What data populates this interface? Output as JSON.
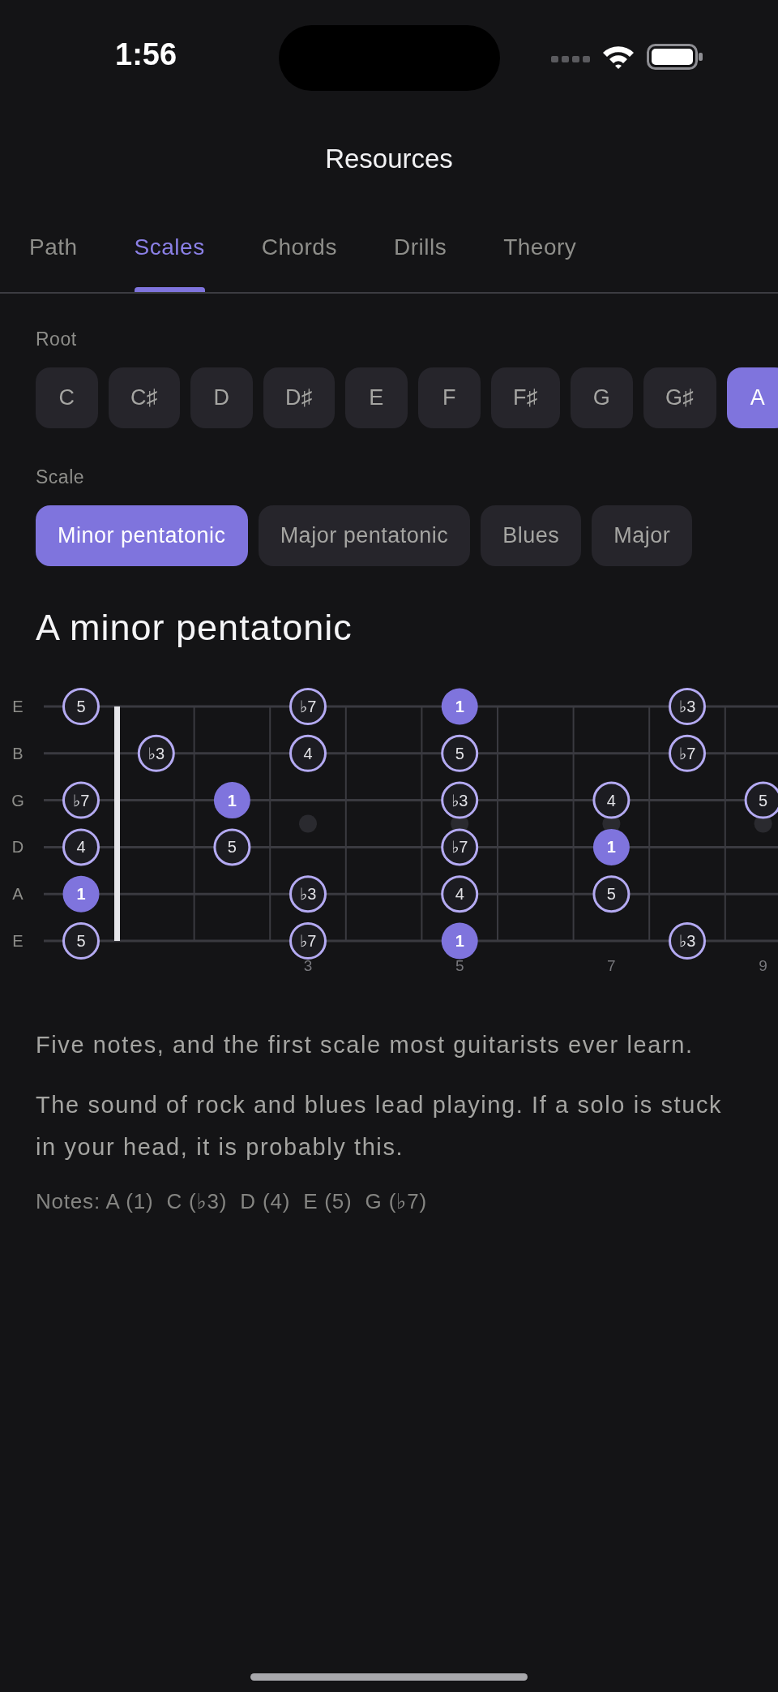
{
  "status_bar": {
    "time": "1:56"
  },
  "title": "Resources",
  "tabs": [
    {
      "label": "Path",
      "selected": false
    },
    {
      "label": "Scales",
      "selected": true
    },
    {
      "label": "Chords",
      "selected": false
    },
    {
      "label": "Drills",
      "selected": false
    },
    {
      "label": "Theory",
      "selected": false
    }
  ],
  "root": {
    "label": "Root",
    "options": [
      {
        "label": "C",
        "selected": false
      },
      {
        "label": "C♯",
        "selected": false
      },
      {
        "label": "D",
        "selected": false
      },
      {
        "label": "D♯",
        "selected": false
      },
      {
        "label": "E",
        "selected": false
      },
      {
        "label": "F",
        "selected": false
      },
      {
        "label": "F♯",
        "selected": false
      },
      {
        "label": "G",
        "selected": false
      },
      {
        "label": "G♯",
        "selected": false
      },
      {
        "label": "A",
        "selected": true
      }
    ]
  },
  "scale": {
    "label": "Scale",
    "options": [
      {
        "label": "Minor pentatonic",
        "selected": true
      },
      {
        "label": "Major pentatonic",
        "selected": false
      },
      {
        "label": "Blues",
        "selected": false
      },
      {
        "label": "Major",
        "selected": false
      }
    ]
  },
  "heading": "A minor pentatonic",
  "fretboard": {
    "frets": [
      {
        "kind": "plain"
      },
      {
        "kind": "plain"
      },
      {
        "kind": "plain"
      },
      {
        "kind": "marked",
        "marker": "3"
      },
      {
        "kind": "plain"
      },
      {
        "kind": "marked",
        "marker": "5"
      },
      {
        "kind": "plain"
      },
      {
        "kind": "marked",
        "marker": "7"
      },
      {
        "kind": "plain"
      },
      {
        "kind": "marked",
        "marker": "9"
      }
    ],
    "strings": [
      {
        "name": "E",
        "slots": [
          {
            "kind": "note",
            "label": "5",
            "root": false
          },
          {
            "kind": "empty"
          },
          {
            "kind": "empty"
          },
          {
            "kind": "note",
            "label": "♭7",
            "root": false
          },
          {
            "kind": "empty"
          },
          {
            "kind": "note",
            "label": "1",
            "root": true
          },
          {
            "kind": "empty"
          },
          {
            "kind": "empty"
          },
          {
            "kind": "note",
            "label": "♭3",
            "root": false
          },
          {
            "kind": "empty"
          }
        ]
      },
      {
        "name": "B",
        "slots": [
          {
            "kind": "empty"
          },
          {
            "kind": "note",
            "label": "♭3",
            "root": false
          },
          {
            "kind": "empty"
          },
          {
            "kind": "note",
            "label": "4",
            "root": false
          },
          {
            "kind": "empty"
          },
          {
            "kind": "note",
            "label": "5",
            "root": false
          },
          {
            "kind": "empty"
          },
          {
            "kind": "empty"
          },
          {
            "kind": "note",
            "label": "♭7",
            "root": false
          },
          {
            "kind": "empty"
          }
        ]
      },
      {
        "name": "G",
        "slots": [
          {
            "kind": "note",
            "label": "♭7",
            "root": false
          },
          {
            "kind": "empty"
          },
          {
            "kind": "note",
            "label": "1",
            "root": true
          },
          {
            "kind": "empty"
          },
          {
            "kind": "empty"
          },
          {
            "kind": "note",
            "label": "♭3",
            "root": false
          },
          {
            "kind": "empty"
          },
          {
            "kind": "note",
            "label": "4",
            "root": false
          },
          {
            "kind": "empty"
          },
          {
            "kind": "note",
            "label": "5",
            "root": false
          }
        ]
      },
      {
        "name": "D",
        "slots": [
          {
            "kind": "note",
            "label": "4",
            "root": false
          },
          {
            "kind": "empty"
          },
          {
            "kind": "note",
            "label": "5",
            "root": false
          },
          {
            "kind": "empty"
          },
          {
            "kind": "empty"
          },
          {
            "kind": "note",
            "label": "♭7",
            "root": false
          },
          {
            "kind": "empty"
          },
          {
            "kind": "note",
            "label": "1",
            "root": true
          },
          {
            "kind": "empty"
          },
          {
            "kind": "empty"
          }
        ]
      },
      {
        "name": "A",
        "slots": [
          {
            "kind": "note",
            "label": "1",
            "root": true
          },
          {
            "kind": "empty"
          },
          {
            "kind": "empty"
          },
          {
            "kind": "note",
            "label": "♭3",
            "root": false
          },
          {
            "kind": "empty"
          },
          {
            "kind": "note",
            "label": "4",
            "root": false
          },
          {
            "kind": "empty"
          },
          {
            "kind": "note",
            "label": "5",
            "root": false
          },
          {
            "kind": "empty"
          },
          {
            "kind": "empty"
          }
        ]
      },
      {
        "name": "E",
        "slots": [
          {
            "kind": "note",
            "label": "5",
            "root": false
          },
          {
            "kind": "empty"
          },
          {
            "kind": "empty"
          },
          {
            "kind": "note",
            "label": "♭7",
            "root": false
          },
          {
            "kind": "empty"
          },
          {
            "kind": "note",
            "label": "1",
            "root": true
          },
          {
            "kind": "empty"
          },
          {
            "kind": "empty"
          },
          {
            "kind": "note",
            "label": "♭3",
            "root": false
          },
          {
            "kind": "empty"
          }
        ]
      }
    ]
  },
  "description": [
    "Five notes, and the first scale most guitarists ever learn.",
    "The sound of rock and blues lead playing. If a solo is stuck in your head, it is probably this."
  ],
  "notes_line": "Notes: A (1)  C (♭3)  D (4)  E (5)  G (♭7)"
}
